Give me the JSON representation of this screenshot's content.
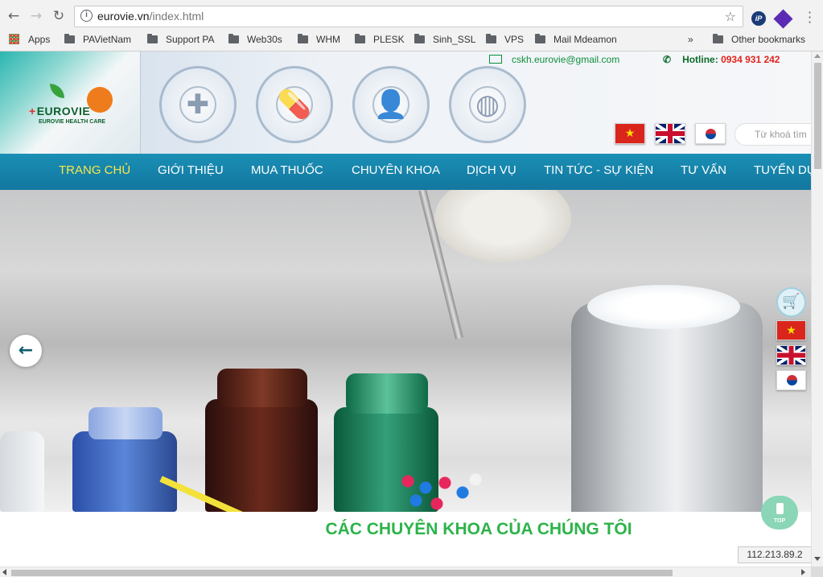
{
  "browser": {
    "url_host": "eurovie.vn",
    "url_path": "/index.html",
    "bookmarks": [
      "Apps",
      "PAVietNam",
      "Support PA",
      "Web30s",
      "WHM",
      "PLESK",
      "Sinh_SSL",
      "VPS",
      "Mail Mdeamon"
    ],
    "overflow": "»",
    "other_bookmarks": "Other bookmarks",
    "ext_label": "iP"
  },
  "header": {
    "logo_name": "EUROVIE",
    "logo_sub": "EUROVIE HEALTH CARE",
    "email": "cskh.eurovie@gmail.com",
    "hotline_label": "Hotline: ",
    "hotline_number": "0934 931 242",
    "search_placeholder": "Từ khoá tìm"
  },
  "nav": {
    "items": [
      "TRANG CHỦ",
      "GIỚI THIỆU",
      "MUA THUỐC",
      "CHUYÊN KHOA",
      "DỊCH VỤ",
      "TIN TỨC - SỰ KIỆN",
      "TƯ VẤN",
      "TUYỂN DỤ"
    ]
  },
  "main": {
    "section_title": "CÁC CHUYÊN KHOA CỦA CHÚNG TÔI",
    "top_label": "TOP"
  },
  "status": {
    "ip": "112.213.89.2"
  },
  "icons": [
    "back-arrow-icon",
    "forward-arrow-icon",
    "reload-icon",
    "info-icon",
    "star-icon",
    "mail-icon",
    "phone-icon",
    "cart-icon",
    "flag-vn-icon",
    "flag-uk-icon",
    "flag-kr-icon"
  ],
  "colors": {
    "nav_bg": "#1a8fb5",
    "nav_active": "#f7e84a",
    "title_green": "#2db34a",
    "hotline_red": "#e0231b"
  }
}
